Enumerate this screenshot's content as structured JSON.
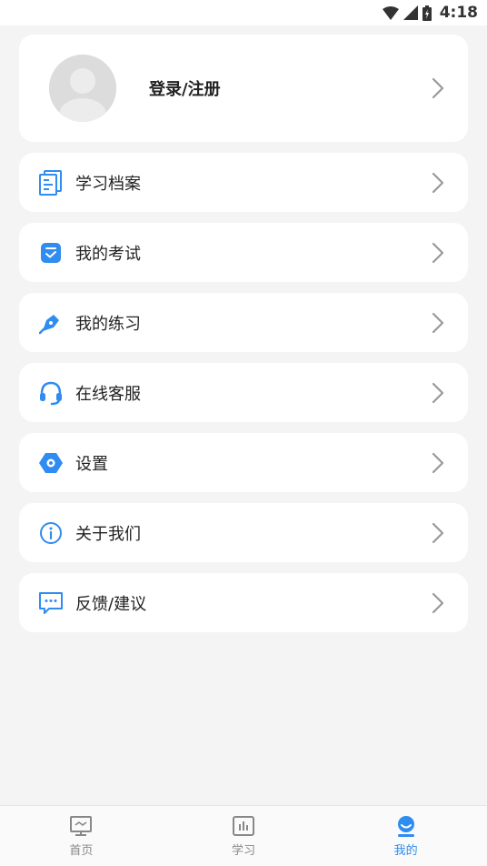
{
  "status_bar": {
    "time": "4:18"
  },
  "profile": {
    "label": "登录/注册"
  },
  "menu": [
    {
      "label": "学习档案",
      "icon": "study-record-icon"
    },
    {
      "label": "我的考试",
      "icon": "exam-icon"
    },
    {
      "label": "我的练习",
      "icon": "practice-icon"
    },
    {
      "label": "在线客服",
      "icon": "headset-icon"
    },
    {
      "label": "设置",
      "icon": "settings-icon"
    },
    {
      "label": "关于我们",
      "icon": "info-icon"
    },
    {
      "label": "反馈/建议",
      "icon": "feedback-icon"
    }
  ],
  "tabs": [
    {
      "label": "首页",
      "icon": "home-icon"
    },
    {
      "label": "学习",
      "icon": "study-icon"
    },
    {
      "label": "我的",
      "icon": "profile-icon"
    }
  ],
  "colors": {
    "accent": "#2f8cf0",
    "background": "#f4f4f4",
    "card": "#ffffff"
  }
}
